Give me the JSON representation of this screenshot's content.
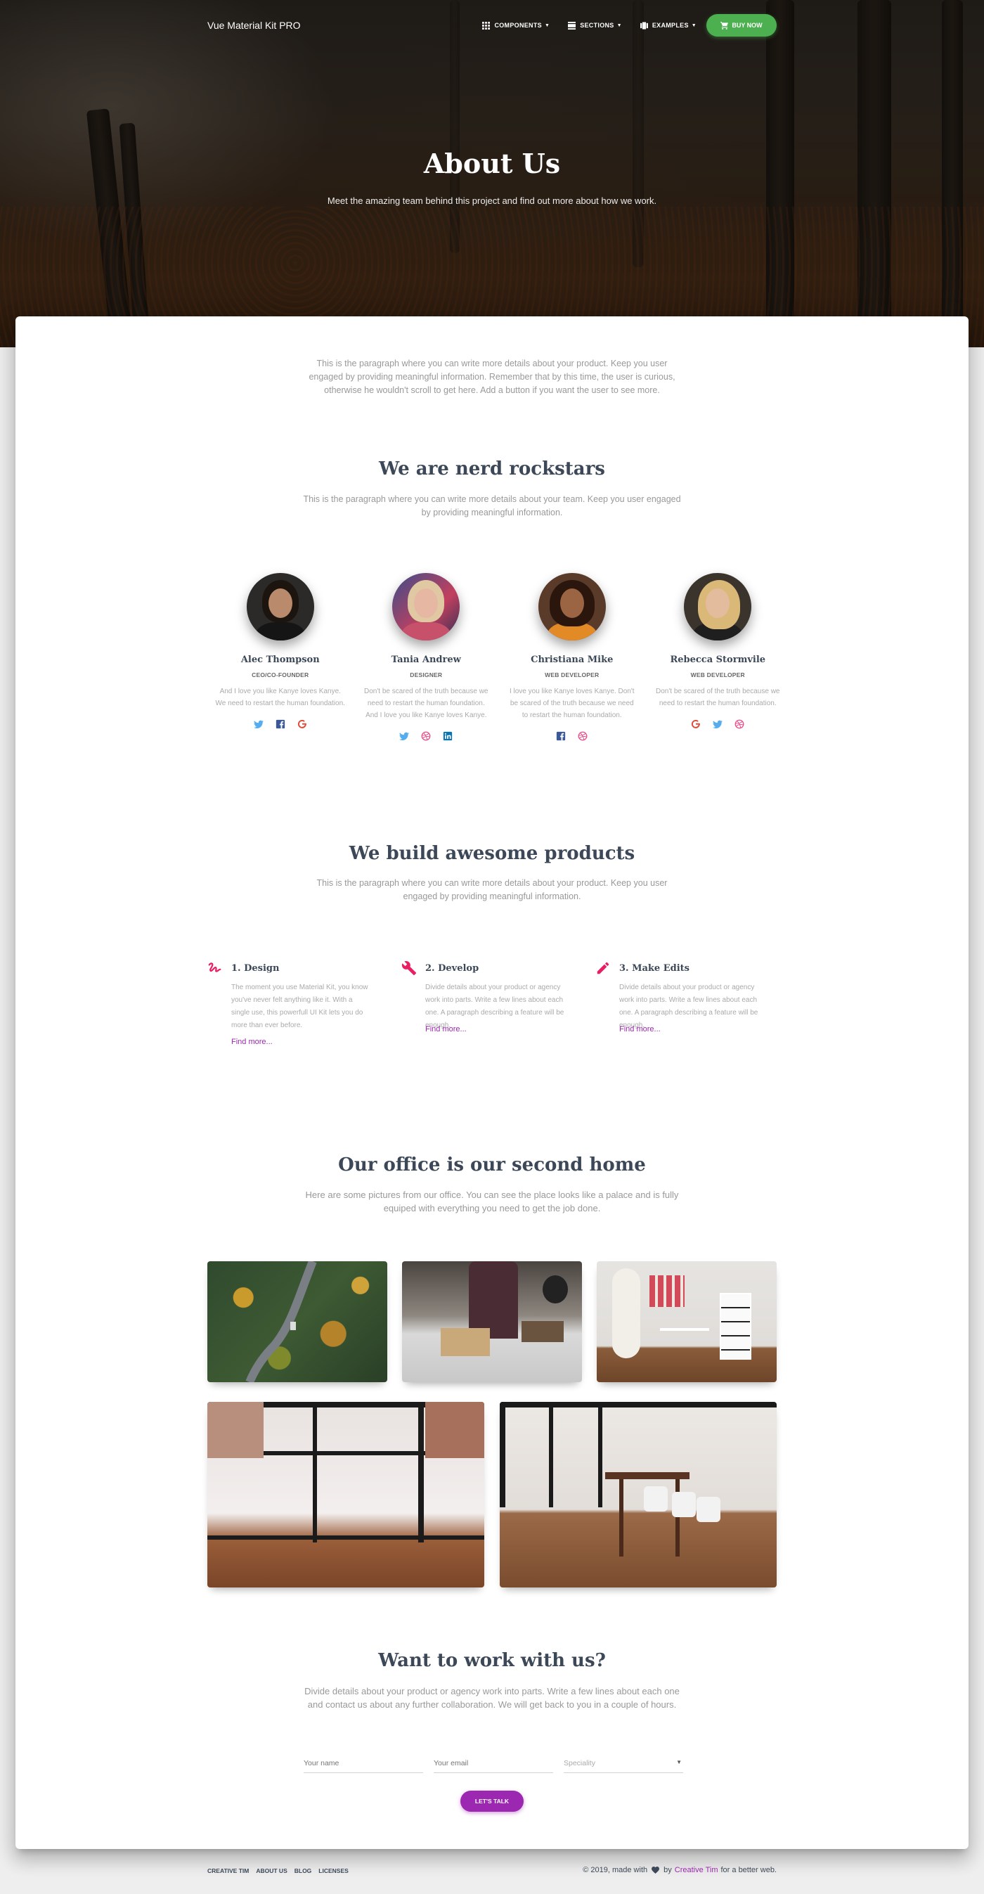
{
  "nav": {
    "brand": "Vue Material Kit PRO",
    "items": [
      {
        "label": "COMPONENTS",
        "icon": "apps-icon"
      },
      {
        "label": "SECTIONS",
        "icon": "view-day-icon"
      },
      {
        "label": "EXAMPLES",
        "icon": "view-carousel-icon"
      }
    ],
    "buy_label": "BUY NOW"
  },
  "hero": {
    "title": "About Us",
    "subtitle": "Meet the amazing team behind this project and find out more about how we work."
  },
  "intro": {
    "line1": "This is the paragraph where you can write more details about your product. Keep you user",
    "line2": "engaged by providing meaningful information. Remember that by this time, the user is curious,",
    "line3": "otherwise he wouldn't scroll to get here. Add a button if you want the user to see more."
  },
  "team": {
    "title": "We are nerd rockstars",
    "desc_line1": "This is the paragraph where you can write more details about your team. Keep you user engaged",
    "desc_line2": "by providing meaningful information.",
    "members": [
      {
        "name": "Alec Thompson",
        "role": "CEO/CO-FOUNDER",
        "desc": "And I love you like Kanye loves Kanye. We need to restart the human foundation.",
        "socials": [
          "twitter-icon",
          "facebook-icon",
          "google-icon"
        ]
      },
      {
        "name": "Tania Andrew",
        "role": "DESIGNER",
        "desc": "Don't be scared of the truth because we need to restart the human foundation. And I love you like Kanye loves Kanye.",
        "socials": [
          "twitter-icon",
          "dribbble-icon",
          "linkedin-icon"
        ]
      },
      {
        "name": "Christiana Mike",
        "role": "WEB DEVELOPER",
        "desc": "I love you like Kanye loves Kanye. Don't be scared of the truth because we need to restart the human foundation.",
        "socials": [
          "facebook-icon",
          "dribbble-icon"
        ]
      },
      {
        "name": "Rebecca Stormvile",
        "role": "WEB DEVELOPER",
        "desc": "Don't be scared of the truth because we need to restart the human foundation.",
        "socials": [
          "google-icon",
          "twitter-icon",
          "dribbble-icon"
        ]
      }
    ]
  },
  "products": {
    "title": "We build awesome products",
    "desc_line1": "This is the paragraph where you can write more details about your product. Keep you user",
    "desc_line2": "engaged by providing meaningful information.",
    "features": [
      {
        "title": "1. Design",
        "icon": "gesture-icon",
        "desc": "The moment you use Material Kit, you know you've never felt anything like it. With a single use, this powerfull UI Kit lets you do more than ever before.",
        "link": "Find more..."
      },
      {
        "title": "2. Develop",
        "icon": "build-icon",
        "desc": "Divide details about your product or agency work into parts. Write a few lines about each one. A paragraph describing a feature will be enough.",
        "link": "Find more..."
      },
      {
        "title": "3. Make Edits",
        "icon": "mode-edit-icon",
        "desc": "Divide details about your product or agency work into parts. Write a few lines about each one. A paragraph describing a feature will be enough.",
        "link": "Find more..."
      }
    ]
  },
  "office": {
    "title": "Our office is our second home",
    "desc_line1": "Here are some pictures from our office. You can see the place looks like a palace and is fully",
    "desc_line2": "equiped with everything you need to get the job done."
  },
  "contact": {
    "title": "Want to work with us?",
    "desc_line1": "Divide details about your product or agency work into parts. Write a few lines about each one",
    "desc_line2": "and contact us about any further collaboration. We will get back to you in a couple of hours.",
    "name_placeholder": "Your name",
    "email_placeholder": "Your email",
    "speciality_placeholder": "Speciality",
    "button": "LET'S TALK"
  },
  "footer": {
    "links": [
      "CREATIVE TIM",
      "ABOUT US",
      "BLOG",
      "LICENSES"
    ],
    "copy_prefix": "© 2019, made with",
    "copy_by": "by",
    "copy_brand": "Creative Tim",
    "copy_suffix": "for a better web."
  },
  "colors": {
    "primary": "#9c27b0",
    "success": "#4caf50",
    "rose": "#e91e63",
    "twitter": "#55acee",
    "facebook": "#3b5998",
    "google": "#dd4b39",
    "dribbble": "#ea4c89",
    "linkedin": "#0976b4"
  }
}
